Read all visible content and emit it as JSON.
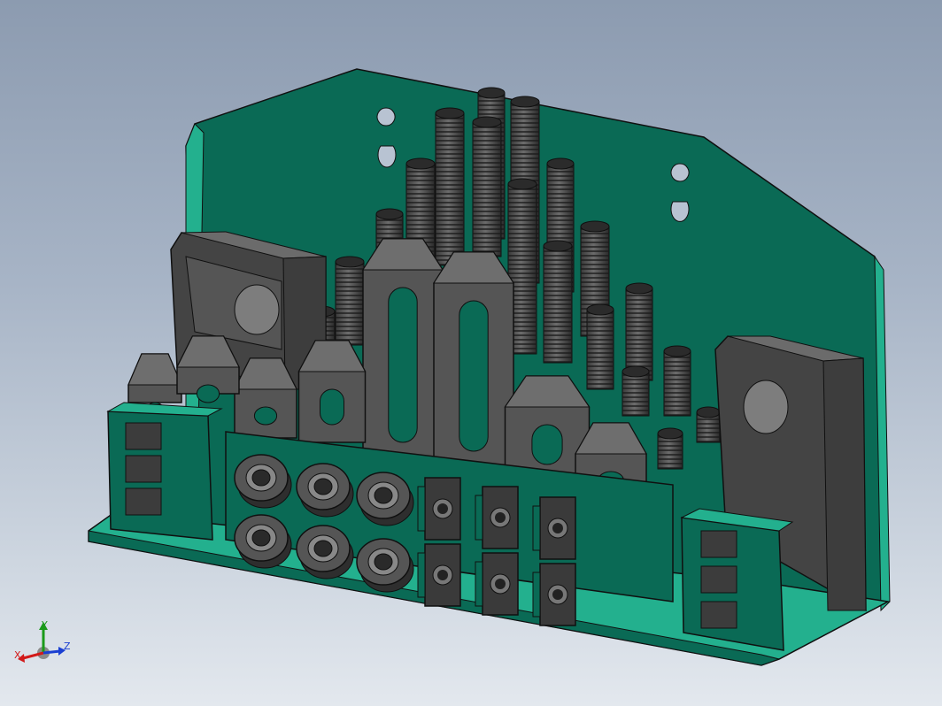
{
  "viewport": {
    "background_top": "#8c9bb0",
    "background_bottom": "#e3e8ee"
  },
  "model": {
    "description_name": "clamping-kit-assembly",
    "plate_color": "#0a6a55",
    "plate_light_color": "#23b08e",
    "part_color": "#555555",
    "part_dark_color": "#2c2c2c",
    "edge_color": "#101010"
  },
  "triad": {
    "x_label": "X",
    "y_label": "Y",
    "z_label": "Z",
    "x_color": "#d21a1a",
    "y_color": "#1a9a1a",
    "z_color": "#1a3fd2"
  }
}
